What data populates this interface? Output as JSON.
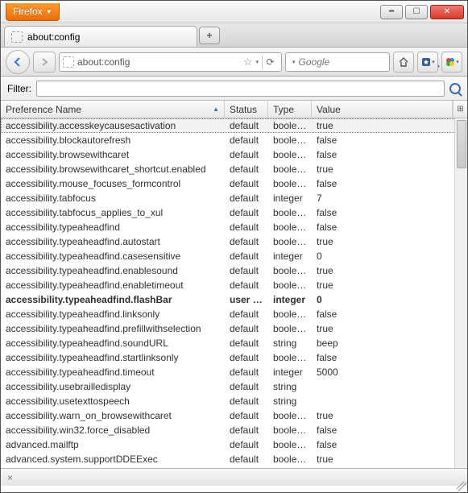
{
  "app": {
    "menu_label": "Firefox"
  },
  "tab": {
    "title": "about:config"
  },
  "nav": {
    "url": "about:config",
    "search_placeholder": "Google"
  },
  "filter": {
    "label": "Filter:",
    "value": ""
  },
  "columns": {
    "name": "Preference Name",
    "status": "Status",
    "type": "Type",
    "value": "Value"
  },
  "statusbar": {
    "text": "×"
  },
  "prefs": [
    {
      "name": "accessibility.accesskeycausesactivation",
      "status": "default",
      "type": "boolean",
      "value": "true",
      "selected": true
    },
    {
      "name": "accessibility.blockautorefresh",
      "status": "default",
      "type": "boolean",
      "value": "false"
    },
    {
      "name": "accessibility.browsewithcaret",
      "status": "default",
      "type": "boolean",
      "value": "false"
    },
    {
      "name": "accessibility.browsewithcaret_shortcut.enabled",
      "status": "default",
      "type": "boolean",
      "value": "true"
    },
    {
      "name": "accessibility.mouse_focuses_formcontrol",
      "status": "default",
      "type": "boolean",
      "value": "false"
    },
    {
      "name": "accessibility.tabfocus",
      "status": "default",
      "type": "integer",
      "value": "7"
    },
    {
      "name": "accessibility.tabfocus_applies_to_xul",
      "status": "default",
      "type": "boolean",
      "value": "false"
    },
    {
      "name": "accessibility.typeaheadfind",
      "status": "default",
      "type": "boolean",
      "value": "false"
    },
    {
      "name": "accessibility.typeaheadfind.autostart",
      "status": "default",
      "type": "boolean",
      "value": "true"
    },
    {
      "name": "accessibility.typeaheadfind.casesensitive",
      "status": "default",
      "type": "integer",
      "value": "0"
    },
    {
      "name": "accessibility.typeaheadfind.enablesound",
      "status": "default",
      "type": "boolean",
      "value": "true"
    },
    {
      "name": "accessibility.typeaheadfind.enabletimeout",
      "status": "default",
      "type": "boolean",
      "value": "true"
    },
    {
      "name": "accessibility.typeaheadfind.flashBar",
      "status": "user set",
      "type": "integer",
      "value": "0",
      "bold": true
    },
    {
      "name": "accessibility.typeaheadfind.linksonly",
      "status": "default",
      "type": "boolean",
      "value": "false"
    },
    {
      "name": "accessibility.typeaheadfind.prefillwithselection",
      "status": "default",
      "type": "boolean",
      "value": "true"
    },
    {
      "name": "accessibility.typeaheadfind.soundURL",
      "status": "default",
      "type": "string",
      "value": "beep"
    },
    {
      "name": "accessibility.typeaheadfind.startlinksonly",
      "status": "default",
      "type": "boolean",
      "value": "false"
    },
    {
      "name": "accessibility.typeaheadfind.timeout",
      "status": "default",
      "type": "integer",
      "value": "5000"
    },
    {
      "name": "accessibility.usebrailledisplay",
      "status": "default",
      "type": "string",
      "value": ""
    },
    {
      "name": "accessibility.usetexttospeech",
      "status": "default",
      "type": "string",
      "value": ""
    },
    {
      "name": "accessibility.warn_on_browsewithcaret",
      "status": "default",
      "type": "boolean",
      "value": "true"
    },
    {
      "name": "accessibility.win32.force_disabled",
      "status": "default",
      "type": "boolean",
      "value": "false"
    },
    {
      "name": "advanced.mailftp",
      "status": "default",
      "type": "boolean",
      "value": "false"
    },
    {
      "name": "advanced.system.supportDDEExec",
      "status": "default",
      "type": "boolean",
      "value": "true"
    }
  ]
}
